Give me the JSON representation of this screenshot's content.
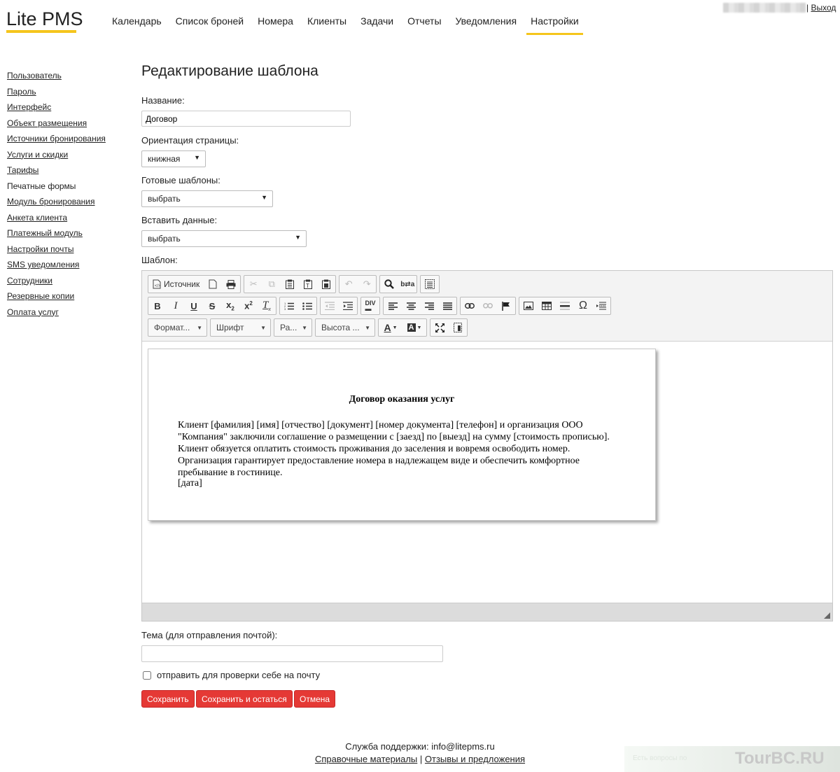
{
  "logo": "Lite PMS",
  "nav": [
    {
      "label": "Календарь",
      "active": false
    },
    {
      "label": "Список броней",
      "active": false
    },
    {
      "label": "Номера",
      "active": false
    },
    {
      "label": "Клиенты",
      "active": false
    },
    {
      "label": "Задачи",
      "active": false
    },
    {
      "label": "Отчеты",
      "active": false
    },
    {
      "label": "Уведомления",
      "active": false
    },
    {
      "label": "Настройки",
      "active": true
    }
  ],
  "logout": "Выход",
  "sidebar": [
    {
      "label": "Пользователь",
      "link": true
    },
    {
      "label": "Пароль",
      "link": true
    },
    {
      "label": "Интерфейс",
      "link": true
    },
    {
      "label": "Объект размещения",
      "link": true
    },
    {
      "label": "Источники бронирования",
      "link": true
    },
    {
      "label": "Услуги и скидки",
      "link": true
    },
    {
      "label": "Тарифы",
      "link": true
    },
    {
      "label": "Печатные формы",
      "link": false
    },
    {
      "label": "Модуль бронирования",
      "link": true
    },
    {
      "label": "Анкета клиента",
      "link": true
    },
    {
      "label": "Платежный модуль",
      "link": true
    },
    {
      "label": "Настройки почты",
      "link": true
    },
    {
      "label": "SMS уведомления",
      "link": true
    },
    {
      "label": "Сотрудники",
      "link": true
    },
    {
      "label": "Резервные копии",
      "link": true
    },
    {
      "label": "Оплата услуг",
      "link": true
    }
  ],
  "form": {
    "title": "Редактирование шаблона",
    "name_label": "Название:",
    "name_value": "Договор",
    "orientation_label": "Ориентация страницы:",
    "orientation_value": "книжная",
    "ready_label": "Готовые шаблоны:",
    "ready_value": "выбрать",
    "insert_label": "Вставить данные:",
    "insert_value": "выбрать",
    "template_label": "Шаблон:",
    "subject_label": "Тема (для отправления почтой):",
    "subject_value": "",
    "check_label": "отправить для проверки себе на почту"
  },
  "toolbar": {
    "source_label": "Источник",
    "format_label": "Формат...",
    "font_label": "Шрифт",
    "size_label": "Ра...",
    "height_label": "Высота ...",
    "bold": "B",
    "italic": "I",
    "underline": "U",
    "strike": "S",
    "omega": "Ω"
  },
  "document": {
    "title": "Договор оказания услуг",
    "body": "Клиент [фамилия] [имя] [отчество] [документ] [номер документа] [телефон] и организация ООО \"Компания\" заключили соглашение о размещении с [заезд] по [выезд] на сумму [стоимость прописью]. Клиент обязуется оплатить стоимость проживания до заселения и вовремя освободить номер. Организация гарантирует предоставление номера в надлежащем виде и обеспечить комфортное пребывание в гостинице.",
    "date": "[дата]"
  },
  "buttons": {
    "save": "Сохранить",
    "save_stay": "Сохранить и остаться",
    "cancel": "Отмена"
  },
  "footer": {
    "support": "Служба поддержки: info@litepms.ru",
    "help": "Справочные материалы",
    "separator": "|",
    "feedback": "Отзывы и предложения"
  },
  "watermark": {
    "brand": "TourBC.RU",
    "note": "Есть вопросы по"
  },
  "colors": {
    "accent": "#f5c51c",
    "button": "#e53935"
  }
}
